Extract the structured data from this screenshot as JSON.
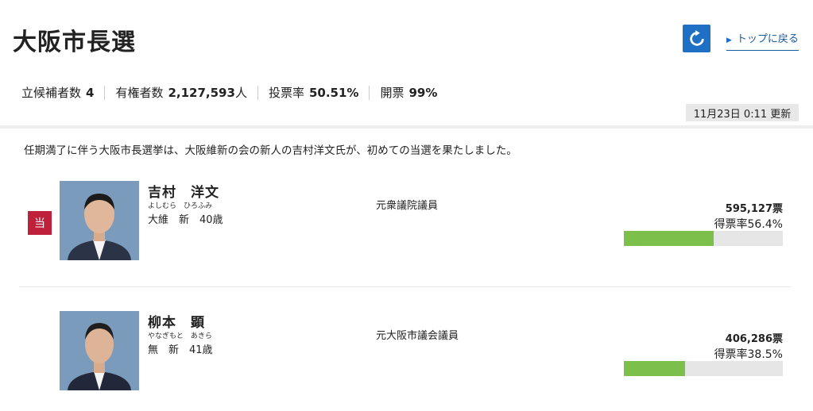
{
  "header": {
    "title": "大阪市長選",
    "refresh_icon": "refresh-icon",
    "back_link": "トップに戻る"
  },
  "stats": {
    "candidates_label": "立候補者数",
    "candidates_value": "4",
    "voters_label": "有権者数",
    "voters_value": "2,127,593",
    "voters_unit": "人",
    "turnout_label": "投票率",
    "turnout_value": "50.51%",
    "counted_label": "開票",
    "counted_value": "99%"
  },
  "updated": "11月23日 0:11 更新",
  "summary": "任期満了に伴う大阪市長選挙は、大阪維新の会の新人の吉村洋文氏が、初めての当選を果たしました。",
  "candidates": [
    {
      "elected_badge": "当",
      "name": "吉村　洋文",
      "kana": "よしむら　ひろふみ",
      "party": "大維　新　40歳",
      "career": "元衆議院議員",
      "votes": "595,127票",
      "rate_label": "得票率56.4%",
      "rate": 56.4
    },
    {
      "elected_badge": "",
      "name": "柳本　顕",
      "kana": "やなぎもと　あきら",
      "party": "無　新　41歳",
      "career": "元大阪市議会議員",
      "votes": "406,286票",
      "rate_label": "得票率38.5%",
      "rate": 38.5
    }
  ],
  "colors": {
    "accent_blue": "#1f6fc5",
    "elected_red": "#c0213a",
    "bar_green": "#7cbf4a"
  }
}
